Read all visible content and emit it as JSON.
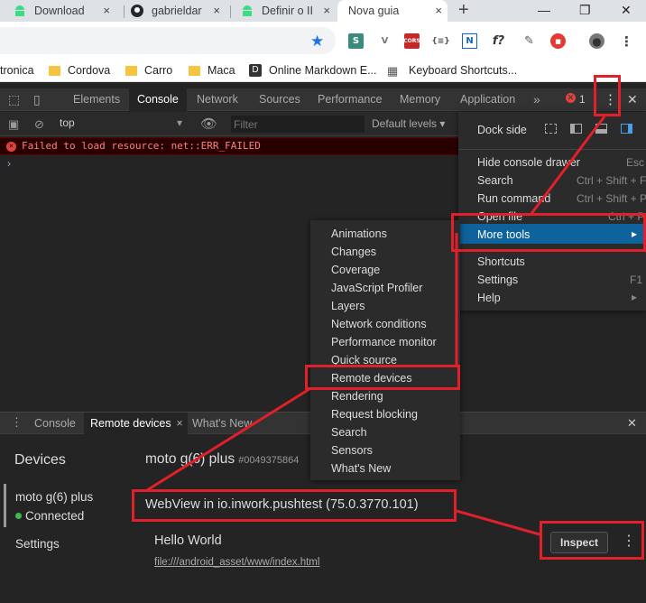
{
  "browser": {
    "tabs": [
      {
        "label": "Download",
        "icon": "android-icon"
      },
      {
        "label": "gabrieldar",
        "icon": "github-icon"
      },
      {
        "label": "Definir o II",
        "icon": "android-icon"
      },
      {
        "label": "Nova guia",
        "icon": ""
      }
    ],
    "close_glyph": "×",
    "newtab_glyph": "+",
    "minimize_glyph": "—",
    "restore_glyph": "❐",
    "window_close_glyph": "✕",
    "bookmarks": [
      {
        "label": "tronica",
        "folder": false
      },
      {
        "label": "Cordova",
        "folder": true
      },
      {
        "label": "Carro",
        "folder": true
      },
      {
        "label": "Maca",
        "folder": true
      },
      {
        "label": "Online Markdown E...",
        "folder": false,
        "badge": "D"
      },
      {
        "label": "Keyboard Shortcuts...",
        "folder": false,
        "badge": "▦"
      }
    ],
    "extensions": [
      "S",
      "V",
      "CORS",
      "{≡}",
      "N",
      "f?",
      "✎",
      "■",
      "●",
      "⋮"
    ]
  },
  "devtools": {
    "tabs": [
      "Elements",
      "Console",
      "Network",
      "Sources",
      "Performance",
      "Memory",
      "Application"
    ],
    "active_tab": "Console",
    "overflow": "»",
    "error_count": "1",
    "context": "top",
    "filter_placeholder": "Filter",
    "levels": "Default levels ▾",
    "error_message": "Failed to load resource: net::ERR_FAILED",
    "prompt": "›",
    "close": "✕",
    "more": "⋮"
  },
  "drawer": {
    "tabs": [
      "Console",
      "Remote devices",
      "What's New"
    ],
    "active_tab": "Remote devices",
    "tab_close": "×",
    "close": "✕"
  },
  "remote": {
    "devices_heading": "Devices",
    "device_name": "moto g(6) plus",
    "device_status": "Connected",
    "settings": "Settings",
    "device_title": "moto g(6) plus",
    "device_serial": "#0049375864",
    "webview_title": "WebView in io.inwork.pushtest (75.0.3770.101)",
    "page_title": "Hello World",
    "page_url": "file:///android_asset/www/index.html",
    "inspect_label": "Inspect",
    "more_glyph": "⋮"
  },
  "main_menu": {
    "dock_side": "Dock side",
    "items": [
      {
        "label": "Hide console drawer",
        "shortcut": "Esc"
      },
      {
        "label": "Search",
        "shortcut": "Ctrl + Shift + F"
      },
      {
        "label": "Run command",
        "shortcut": "Ctrl + Shift + P"
      },
      {
        "label": "Open file",
        "shortcut": "Ctrl + P"
      },
      {
        "label": "More tools",
        "shortcut": "▸"
      },
      {
        "label": "Shortcuts",
        "shortcut": ""
      },
      {
        "label": "Settings",
        "shortcut": "F1"
      },
      {
        "label": "Help",
        "shortcut": "▸"
      }
    ]
  },
  "more_tools": [
    "Animations",
    "Changes",
    "Coverage",
    "JavaScript Profiler",
    "Layers",
    "Network conditions",
    "Performance monitor",
    "Quick source",
    "Remote devices",
    "Rendering",
    "Request blocking",
    "Search",
    "Sensors",
    "What's New"
  ],
  "colors": {
    "annotation_red": "#e0202a",
    "menu_highlight": "#0e639c",
    "connected_green": "#3cba54"
  }
}
